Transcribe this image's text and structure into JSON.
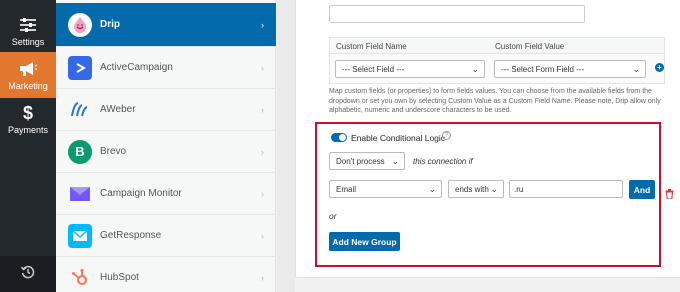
{
  "rail": {
    "items": [
      {
        "label": "Settings",
        "icon": "sliders-icon"
      },
      {
        "label": "Marketing",
        "icon": "megaphone-icon",
        "active": true
      },
      {
        "label": "Payments",
        "icon": "dollar-icon"
      }
    ],
    "bottom_icon": "history-icon"
  },
  "providers": [
    {
      "name": "Drip",
      "active": true
    },
    {
      "name": "ActiveCampaign"
    },
    {
      "name": "AWeber"
    },
    {
      "name": "Brevo"
    },
    {
      "name": "Campaign Monitor"
    },
    {
      "name": "GetResponse"
    },
    {
      "name": "HubSpot"
    }
  ],
  "chevron": "›",
  "custom_fields": {
    "col_name": "Custom Field Name",
    "col_value": "Custom Field Value",
    "field_select": "--- Select Field ---",
    "value_select": "--- Select Form Field ---"
  },
  "help_text": "Map custom fields (or properties) to form fields values. You can choose from the available fields from the dropdown or set you own by selecting Custom Value as a Custom Field Name. Please note, Drip allow only alphabetic, numeric and underscore characters to be used.",
  "logic": {
    "toggle_label": "Enable Conditional Logic",
    "qmark": "?",
    "action": "Don't process",
    "action_suffix": "this connection if",
    "field": "Email",
    "operator": "ends with",
    "value": ".ru",
    "and_label": "And",
    "or_label": "or",
    "add_group_label": "Add New Group"
  },
  "colors": {
    "accent": "#036aab",
    "marketing": "#e27730",
    "highlight": "#c8102e",
    "trash": "#d63638"
  }
}
